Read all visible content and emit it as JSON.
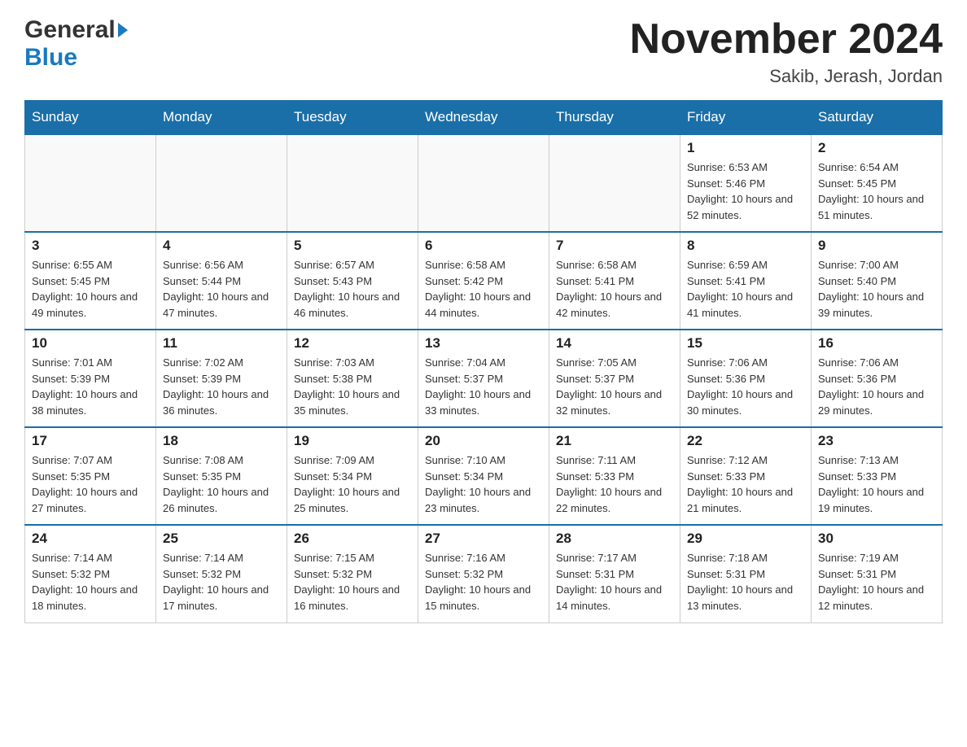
{
  "header": {
    "logo_general": "General",
    "logo_blue": "Blue",
    "month_title": "November 2024",
    "location": "Sakib, Jerash, Jordan"
  },
  "weekdays": [
    "Sunday",
    "Monday",
    "Tuesday",
    "Wednesday",
    "Thursday",
    "Friday",
    "Saturday"
  ],
  "weeks": [
    [
      {
        "day": "",
        "empty": true
      },
      {
        "day": "",
        "empty": true
      },
      {
        "day": "",
        "empty": true
      },
      {
        "day": "",
        "empty": true
      },
      {
        "day": "",
        "empty": true
      },
      {
        "day": "1",
        "sunrise": "6:53 AM",
        "sunset": "5:46 PM",
        "daylight": "10 hours and 52 minutes."
      },
      {
        "day": "2",
        "sunrise": "6:54 AM",
        "sunset": "5:45 PM",
        "daylight": "10 hours and 51 minutes."
      }
    ],
    [
      {
        "day": "3",
        "sunrise": "6:55 AM",
        "sunset": "5:45 PM",
        "daylight": "10 hours and 49 minutes."
      },
      {
        "day": "4",
        "sunrise": "6:56 AM",
        "sunset": "5:44 PM",
        "daylight": "10 hours and 47 minutes."
      },
      {
        "day": "5",
        "sunrise": "6:57 AM",
        "sunset": "5:43 PM",
        "daylight": "10 hours and 46 minutes."
      },
      {
        "day": "6",
        "sunrise": "6:58 AM",
        "sunset": "5:42 PM",
        "daylight": "10 hours and 44 minutes."
      },
      {
        "day": "7",
        "sunrise": "6:58 AM",
        "sunset": "5:41 PM",
        "daylight": "10 hours and 42 minutes."
      },
      {
        "day": "8",
        "sunrise": "6:59 AM",
        "sunset": "5:41 PM",
        "daylight": "10 hours and 41 minutes."
      },
      {
        "day": "9",
        "sunrise": "7:00 AM",
        "sunset": "5:40 PM",
        "daylight": "10 hours and 39 minutes."
      }
    ],
    [
      {
        "day": "10",
        "sunrise": "7:01 AM",
        "sunset": "5:39 PM",
        "daylight": "10 hours and 38 minutes."
      },
      {
        "day": "11",
        "sunrise": "7:02 AM",
        "sunset": "5:39 PM",
        "daylight": "10 hours and 36 minutes."
      },
      {
        "day": "12",
        "sunrise": "7:03 AM",
        "sunset": "5:38 PM",
        "daylight": "10 hours and 35 minutes."
      },
      {
        "day": "13",
        "sunrise": "7:04 AM",
        "sunset": "5:37 PM",
        "daylight": "10 hours and 33 minutes."
      },
      {
        "day": "14",
        "sunrise": "7:05 AM",
        "sunset": "5:37 PM",
        "daylight": "10 hours and 32 minutes."
      },
      {
        "day": "15",
        "sunrise": "7:06 AM",
        "sunset": "5:36 PM",
        "daylight": "10 hours and 30 minutes."
      },
      {
        "day": "16",
        "sunrise": "7:06 AM",
        "sunset": "5:36 PM",
        "daylight": "10 hours and 29 minutes."
      }
    ],
    [
      {
        "day": "17",
        "sunrise": "7:07 AM",
        "sunset": "5:35 PM",
        "daylight": "10 hours and 27 minutes."
      },
      {
        "day": "18",
        "sunrise": "7:08 AM",
        "sunset": "5:35 PM",
        "daylight": "10 hours and 26 minutes."
      },
      {
        "day": "19",
        "sunrise": "7:09 AM",
        "sunset": "5:34 PM",
        "daylight": "10 hours and 25 minutes."
      },
      {
        "day": "20",
        "sunrise": "7:10 AM",
        "sunset": "5:34 PM",
        "daylight": "10 hours and 23 minutes."
      },
      {
        "day": "21",
        "sunrise": "7:11 AM",
        "sunset": "5:33 PM",
        "daylight": "10 hours and 22 minutes."
      },
      {
        "day": "22",
        "sunrise": "7:12 AM",
        "sunset": "5:33 PM",
        "daylight": "10 hours and 21 minutes."
      },
      {
        "day": "23",
        "sunrise": "7:13 AM",
        "sunset": "5:33 PM",
        "daylight": "10 hours and 19 minutes."
      }
    ],
    [
      {
        "day": "24",
        "sunrise": "7:14 AM",
        "sunset": "5:32 PM",
        "daylight": "10 hours and 18 minutes."
      },
      {
        "day": "25",
        "sunrise": "7:14 AM",
        "sunset": "5:32 PM",
        "daylight": "10 hours and 17 minutes."
      },
      {
        "day": "26",
        "sunrise": "7:15 AM",
        "sunset": "5:32 PM",
        "daylight": "10 hours and 16 minutes."
      },
      {
        "day": "27",
        "sunrise": "7:16 AM",
        "sunset": "5:32 PM",
        "daylight": "10 hours and 15 minutes."
      },
      {
        "day": "28",
        "sunrise": "7:17 AM",
        "sunset": "5:31 PM",
        "daylight": "10 hours and 14 minutes."
      },
      {
        "day": "29",
        "sunrise": "7:18 AM",
        "sunset": "5:31 PM",
        "daylight": "10 hours and 13 minutes."
      },
      {
        "day": "30",
        "sunrise": "7:19 AM",
        "sunset": "5:31 PM",
        "daylight": "10 hours and 12 minutes."
      }
    ]
  ]
}
